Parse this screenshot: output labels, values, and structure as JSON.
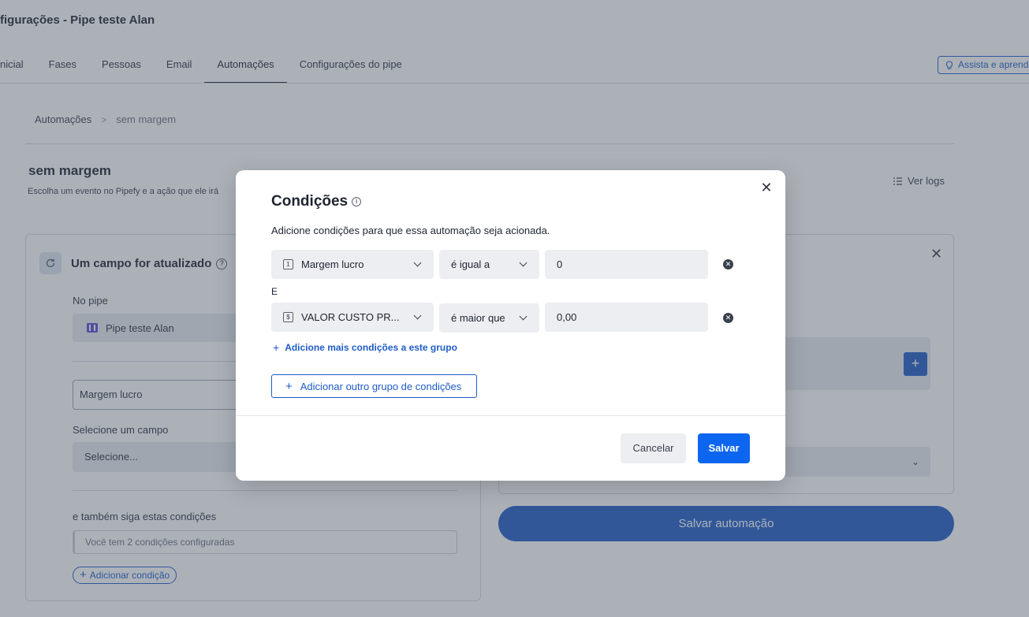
{
  "header": {
    "title": "figurações - Pipe teste Alan",
    "tabs": [
      {
        "label": "nicial"
      },
      {
        "label": "Fases"
      },
      {
        "label": "Pessoas"
      },
      {
        "label": "Email"
      },
      {
        "label": "Automações"
      },
      {
        "label": "Configurações do pipe"
      }
    ],
    "active_tab": "Automações",
    "help_label": "Assista e aprend"
  },
  "breadcrumb": {
    "root": "Automações",
    "separator": ">",
    "current": "sem margem"
  },
  "automation": {
    "title": "sem margem",
    "description": "Escolha um evento no Pipefy e a ação que ele irá",
    "logs_label": "Ver logs"
  },
  "trigger_card": {
    "title": "Um campo for atualizado",
    "help_glyph": "?",
    "pipe_label": "No pipe",
    "pipe_value": "Pipe teste Alan",
    "field_value": "Margem lucro",
    "select_field_label": "Selecione um campo",
    "select_placeholder": "Selecione...",
    "conditions_label": "e também siga estas condições",
    "conditions_summary": "Você tem 2 condições configuradas",
    "add_condition_label": "Adicionar condição"
  },
  "action_card": {
    "close_glyph": "✕",
    "plus_glyph": "+",
    "save_automation_label": "Salvar automação"
  },
  "modal": {
    "title": "Condições",
    "info_glyph": "i",
    "subtitle": "Adicione condições para que essa automação seja acionada.",
    "close_glyph": "✕",
    "conditions": [
      {
        "type_glyph": "1",
        "field": "Margem lucro",
        "operator": "é igual a",
        "value": "0"
      },
      {
        "type_glyph": "$",
        "field": "VALOR CUSTO PR...",
        "operator": "é maior que",
        "value": "0,00"
      }
    ],
    "joiner": "E",
    "add_more_label": "Adicione mais condições a este grupo",
    "add_group_label": "Adicionar outro grupo de condições",
    "plus_glyph": "+",
    "cancel_label": "Cancelar",
    "save_label": "Salvar"
  },
  "colors": {
    "primary": "#1f5cc7",
    "save_button": "#0d66f0",
    "overlay": "#485262",
    "field_bg": "#eceef1"
  }
}
